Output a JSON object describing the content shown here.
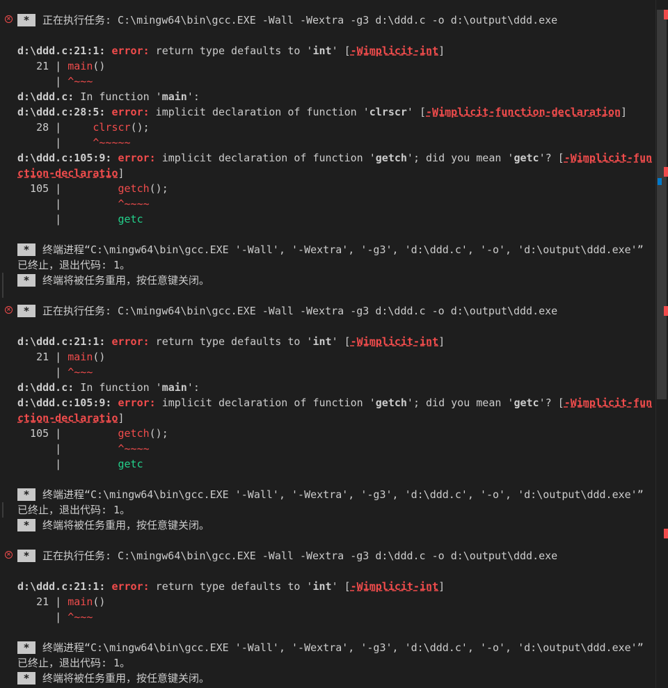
{
  "terminal": {
    "star": "*",
    "blocks": [
      {
        "task_header": "正在执行任务: C:\\mingw64\\bin\\gcc.EXE -Wall -Wextra -g3 d:\\ddd.c -o d:\\output\\ddd.exe",
        "diag1": {
          "loc": "d:\\ddd.c:21:1:",
          "kind": "error:",
          "msg": " return type defaults to '",
          "kw": "int",
          "tail": "' [",
          "flag": "-Wimplicit-int",
          "close": "]"
        },
        "src21": {
          "num": "   21 | ",
          "code": "main",
          "rest": "()"
        },
        "caret21": {
          "gutter": "      | ",
          "caret": "^~~~"
        },
        "infn": {
          "file": "d:\\ddd.c:",
          "text": " In function '",
          "fn": "main",
          "end": "':"
        },
        "diag2": {
          "loc": "d:\\ddd.c:28:5:",
          "kind": "error:",
          "msg": " implicit declaration of function '",
          "kw": "clrscr",
          "tail": "' [",
          "flag": "-Wimplicit-function-declaration",
          "close": "]"
        },
        "src28": {
          "num": "   28 | ",
          "pad": "    ",
          "code": "clrscr",
          "rest": "();"
        },
        "caret28": {
          "gutter": "      | ",
          "pad": "    ",
          "caret": "^~~~~~"
        },
        "diag3": {
          "loc": "d:\\ddd.c:105:9:",
          "kind": "error:",
          "msg": " implicit declaration of function '",
          "kw": "getch",
          "mid": "'; did you mean '",
          "kw2": "getc",
          "tail": "'? [",
          "flag1": "-Wimplicit-fun",
          "flag2": "ction-declaratio",
          "close": "]"
        },
        "src105": {
          "num": "  105 | ",
          "pad": "        ",
          "code": "getch",
          "rest": "();"
        },
        "caret105": {
          "gutter": "      | ",
          "pad": "        ",
          "caret": "^~~~~"
        },
        "hint105": {
          "gutter": "      | ",
          "pad": "        ",
          "hint": "getc"
        },
        "end1": "终端进程“C:\\mingw64\\bin\\gcc.EXE '-Wall', '-Wextra', '-g3', 'd:\\ddd.c', '-o', 'd:\\output\\ddd.exe'”",
        "end2": "已终止，退出代码: 1。",
        "end3": "终端将被任务重用，按任意键关闭。"
      }
    ]
  },
  "icons": {
    "error": "error-circle-icon",
    "star": "asterisk-badge-icon"
  },
  "colors": {
    "background": "#1e1e1e",
    "foreground": "#cccccc",
    "error": "#f14c4c",
    "suggestion": "#23d18b",
    "badge": "#c8c8c8"
  }
}
